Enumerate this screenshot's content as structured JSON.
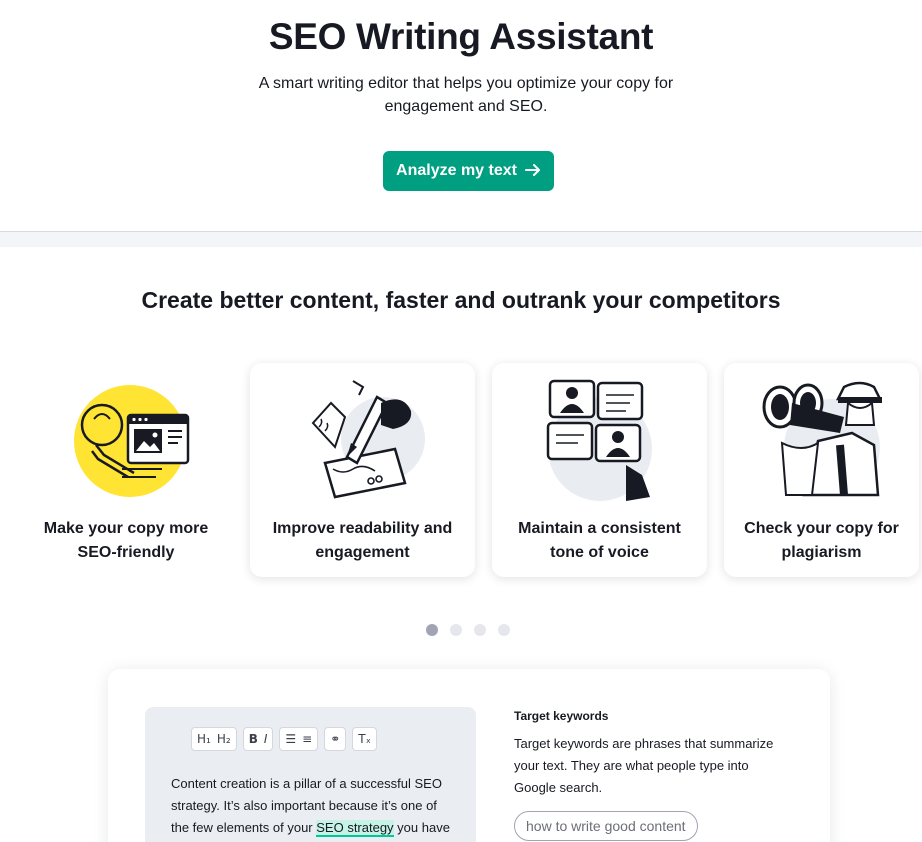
{
  "hero": {
    "title": "SEO Writing Assistant",
    "subtitle": "A smart writing editor that helps you optimize your copy for engagement and SEO.",
    "cta_label": "Analyze my text",
    "cta_icon": "arrow-right-icon",
    "accent_color": "#009f81"
  },
  "features": {
    "heading": "Create better content, faster and outrank your competitors",
    "cards": [
      {
        "title": "Make your copy more SEO-friendly",
        "icon": "lightbulb-browser-illustration"
      },
      {
        "title": "Improve readability and engagement",
        "icon": "hand-writing-illustration"
      },
      {
        "title": "Maintain a consistent tone of voice",
        "icon": "puzzle-people-illustration"
      },
      {
        "title": "Check your copy for plagiarism",
        "icon": "binoculars-detective-illustration"
      }
    ],
    "carousel": {
      "pages": 4,
      "active": 1
    }
  },
  "editor": {
    "toolbar": {
      "h1": "H₁",
      "h2": "H₂",
      "bold": "B",
      "italic": "I",
      "ordered_list": "☰",
      "bullet_list": "≡",
      "link": "⚭",
      "clear_format": "Tₓ"
    },
    "text_before": "Content creation is a pillar of a successful SEO strategy. It’s also important because it’s one of the few elements of your ",
    "highlight": "SEO strategy",
    "text_after": " you have"
  },
  "keywords": {
    "heading": "Target keywords",
    "description": "Target keywords are phrases that summarize your text. They are what people type into Google search.",
    "chip": "how to write good content"
  }
}
